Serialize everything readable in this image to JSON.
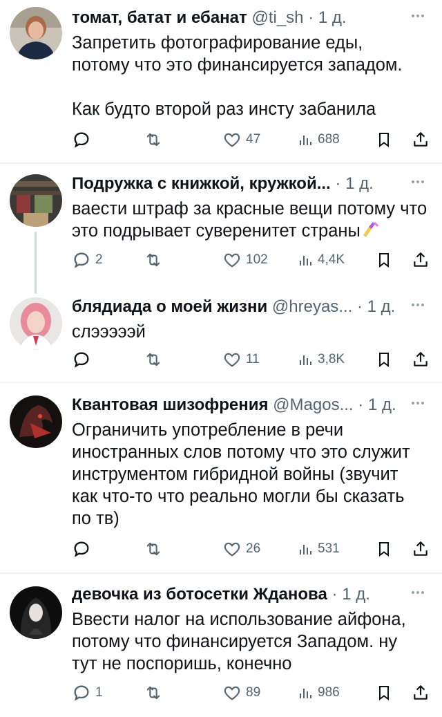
{
  "tweets": [
    {
      "name": "томат, батат и ебанат",
      "handle": "@ti_sh",
      "sep": "·",
      "time": "1 д.",
      "text": "Запретить фотографирование еды,\nпотому что это финансируется западом.\n\nКак будто второй раз инсту забанила",
      "replies": "",
      "retweets": "",
      "likes": "47",
      "views": "688"
    },
    {
      "name": "Подружка с книжкой, кружкой...",
      "handle": "",
      "sep": "·",
      "time": "1 д.",
      "text": "ваести штраф за красные вещи потому что\nэто подрывает суверенитет страны",
      "replies": "2",
      "retweets": "",
      "likes": "102",
      "views": "4,4K"
    },
    {
      "name": "блядиада о моей жизни",
      "handle": "@hreyas...",
      "sep": "·",
      "time": "1 д.",
      "text": "слэээээй",
      "replies": "",
      "retweets": "",
      "likes": "11",
      "views": "3,8K"
    },
    {
      "name": "Квантовая шизофрения",
      "handle": "@Magos...",
      "sep": "·",
      "time": "1 д.",
      "text": "Ограничить употребление в речи\nиностранных слов потому что это служит\nинструментом гибридной войны (звучит\nкак что-то что реально могли бы сказать\nпо тв)",
      "replies": "",
      "retweets": "",
      "likes": "26",
      "views": "531"
    },
    {
      "name": "девочка из ботосетки Жданова",
      "handle": "",
      "sep": "·",
      "time": "1 д.",
      "text": "Ввести налог на использование айфона,\nпотому что финансируется Западом. ну\nтут не поспоришь, конечно",
      "replies": "1",
      "retweets": "",
      "likes": "89",
      "views": "986"
    }
  ],
  "colors": {
    "text": "#0f1419",
    "muted": "#536471",
    "divider": "#eff3f4"
  }
}
